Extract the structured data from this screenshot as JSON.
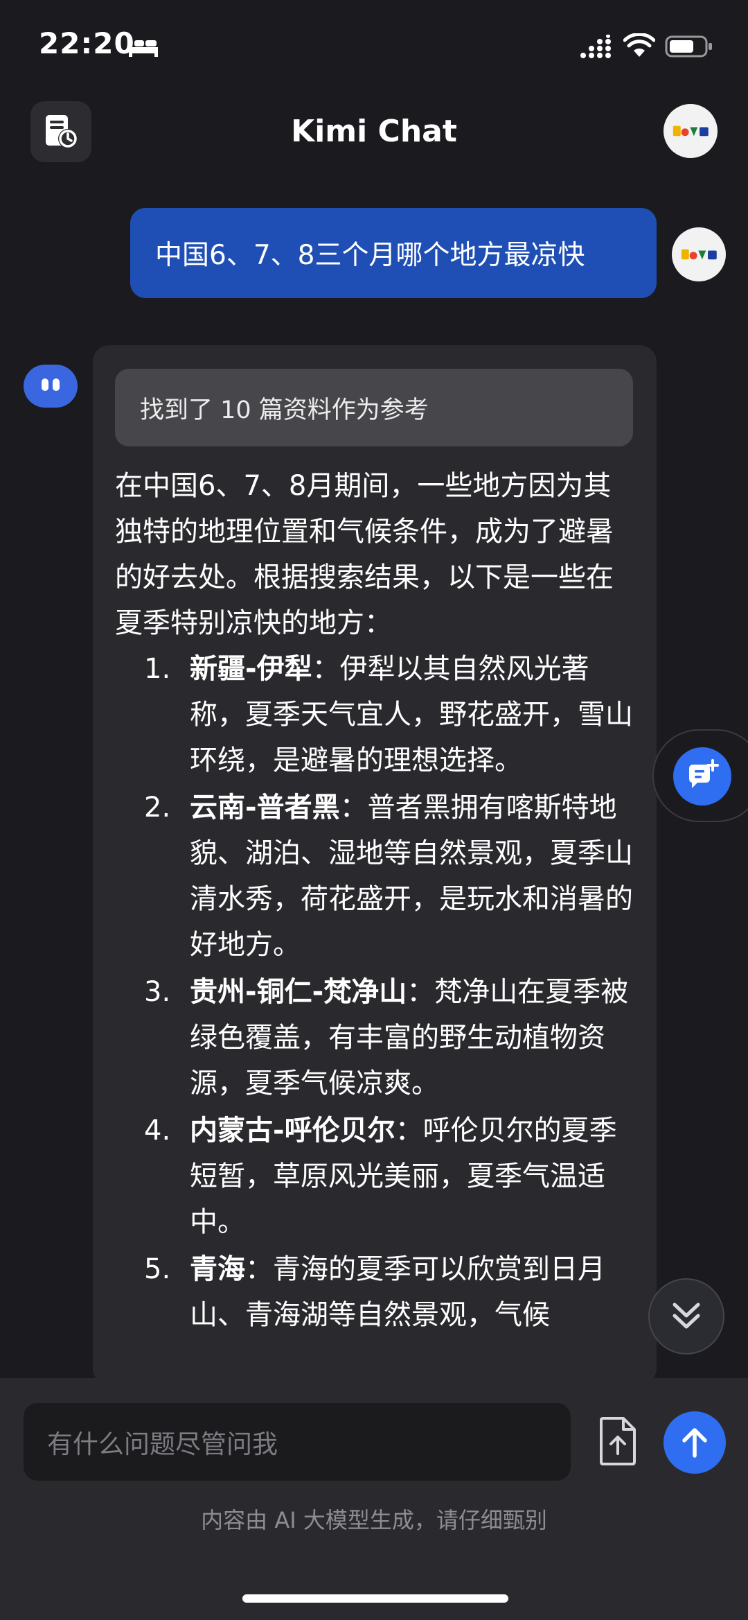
{
  "status_bar": {
    "time": "22:20"
  },
  "header": {
    "title": "Kimi Chat"
  },
  "user_message": {
    "text": "中国6、7、8三个月哪个地方最凉快"
  },
  "assistant": {
    "references_label": "找到了 10 篇资料作为参考",
    "intro": "在中国6、7、8月期间，一些地方因为其独特的地理位置和气候条件，成为了避暑的好去处。根据搜索结果，以下是一些在夏季特别凉快的地方：",
    "items": [
      {
        "num": "1.",
        "name": "新疆-伊犁",
        "desc": "：伊犁以其自然风光著称，夏季天气宜人，野花盛开，雪山环绕，是避暑的理想选择。"
      },
      {
        "num": "2.",
        "name": "云南-普者黑",
        "desc": "：普者黑拥有喀斯特地貌、湖泊、湿地等自然景观，夏季山清水秀，荷花盛开，是玩水和消暑的好地方。"
      },
      {
        "num": "3.",
        "name": "贵州-铜仁-梵净山",
        "desc": "：梵净山在夏季被绿色覆盖，有丰富的野生动植物资源，夏季气候凉爽。"
      },
      {
        "num": "4.",
        "name": "内蒙古-呼伦贝尔",
        "desc": "：呼伦贝尔的夏季短暂，草原风光美丽，夏季气温适中。"
      },
      {
        "num": "5.",
        "name": "青海",
        "desc": "：青海的夏季可以欣赏到日月山、青海湖等自然景观，气候"
      }
    ]
  },
  "composer": {
    "placeholder": "有什么问题尽管问我",
    "disclaimer": "内容由 AI 大模型生成，请仔细甄别"
  },
  "icons": {
    "bed": "bed-icon",
    "signal": "cellular-signal-icon",
    "wifi": "wifi-icon",
    "battery": "battery-icon",
    "history": "history-icon",
    "new_chat": "new-chat-icon",
    "scroll_down": "double-chevron-down-icon",
    "upload": "file-upload-icon",
    "send": "arrow-up-icon"
  },
  "colors": {
    "background": "#1b1b1f",
    "user_bubble": "#1f4fb5",
    "assistant_bubble": "#2a2a2e",
    "accent": "#2f6ef0"
  }
}
